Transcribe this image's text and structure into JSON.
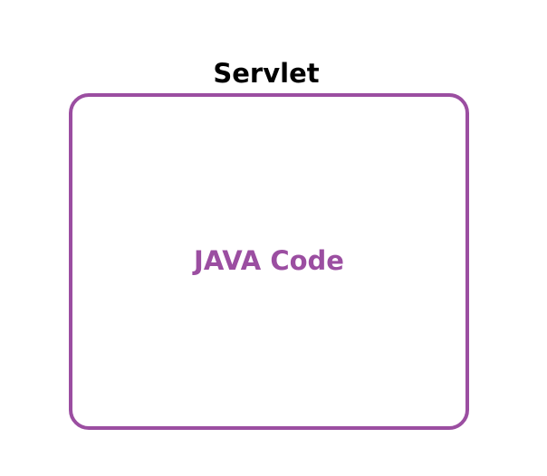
{
  "title": "Servlet",
  "box": {
    "label": "JAVA Code"
  },
  "colors": {
    "accent": "#9b4ea1",
    "title_text": "#000000",
    "background": "#ffffff"
  }
}
